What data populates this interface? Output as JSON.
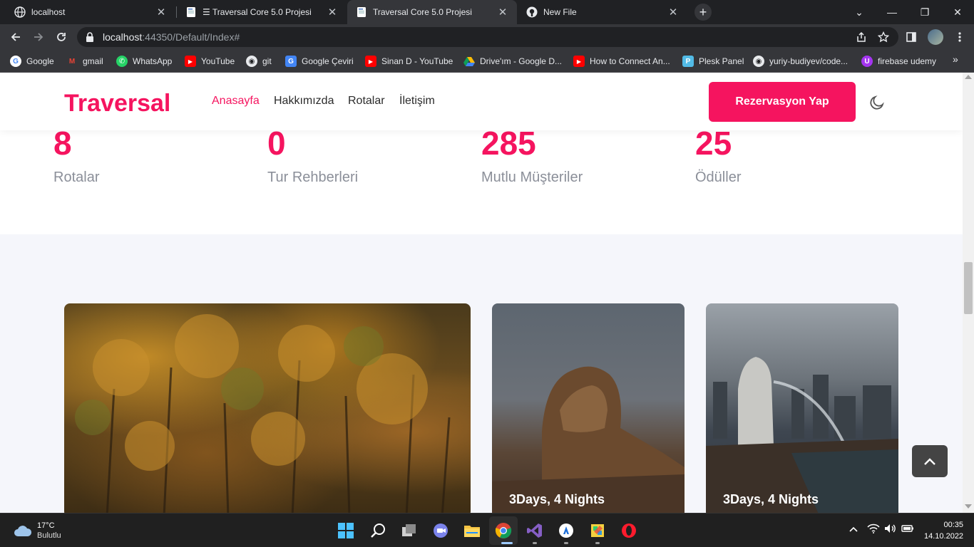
{
  "browser": {
    "tabs": [
      {
        "title": "localhost",
        "active": false
      },
      {
        "title": "☰ Traversal Core 5.0 Projesi",
        "active": false
      },
      {
        "title": "Traversal Core 5.0 Projesi",
        "active": true
      },
      {
        "title": "New File",
        "active": false
      }
    ],
    "url_host": "localhost",
    "url_rest": ":44350/Default/Index#",
    "bookmarks": [
      {
        "label": "Google",
        "icon": "google-icon"
      },
      {
        "label": "gmail",
        "icon": "gmail-icon"
      },
      {
        "label": "WhatsApp",
        "icon": "whatsapp-icon"
      },
      {
        "label": "YouTube",
        "icon": "youtube-icon"
      },
      {
        "label": "git",
        "icon": "github-icon"
      },
      {
        "label": "Google Çeviri",
        "icon": "translate-icon"
      },
      {
        "label": "Sinan D - YouTube",
        "icon": "youtube-icon"
      },
      {
        "label": "Drive'ım - Google D...",
        "icon": "drive-icon"
      },
      {
        "label": "How to Connect An...",
        "icon": "youtube-icon"
      },
      {
        "label": "Plesk Panel",
        "icon": "plesk-icon"
      },
      {
        "label": "yuriy-budiyev/code...",
        "icon": "github-icon"
      },
      {
        "label": "firebase udemy",
        "icon": "udemy-icon"
      }
    ]
  },
  "site": {
    "logo": "Traversal",
    "menu": [
      {
        "label": "Anasayfa",
        "active": true
      },
      {
        "label": "Hakkımızda",
        "active": false
      },
      {
        "label": "Rotalar",
        "active": false
      },
      {
        "label": "İletişim",
        "active": false
      }
    ],
    "cta_label": "Rezervasyon Yap",
    "accent": "#f5145f"
  },
  "stats": [
    {
      "value": "8",
      "label": "Rotalar"
    },
    {
      "value": "0",
      "label": "Tur Rehberleri"
    },
    {
      "value": "285",
      "label": "Mutlu Müşteriler"
    },
    {
      "value": "25",
      "label": "Ödüller"
    }
  ],
  "cards": [
    {
      "caption": ""
    },
    {
      "caption": "3Days, 4 Nights"
    },
    {
      "caption": "3Days, 4 Nights"
    }
  ],
  "taskbar": {
    "temperature": "17°C",
    "weather": "Bulutlu",
    "time": "00:35",
    "date": "14.10.2022"
  }
}
